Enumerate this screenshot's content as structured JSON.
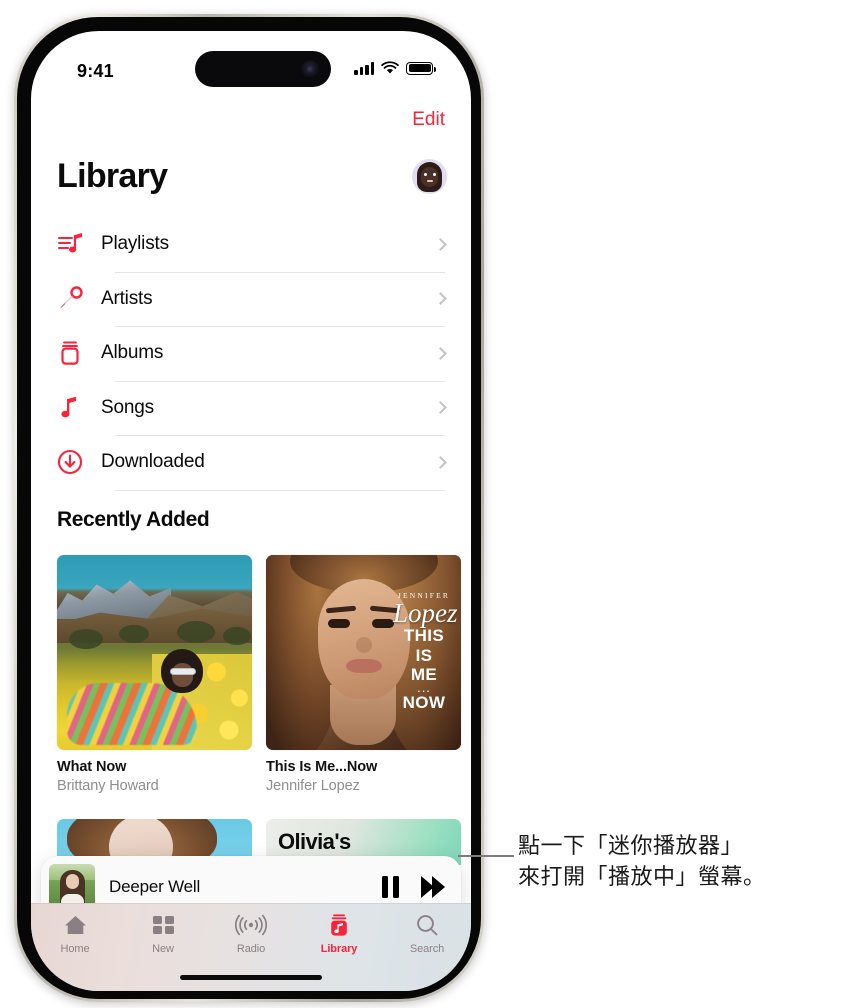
{
  "status_bar": {
    "time": "9:41",
    "icons": [
      "cellular-signal-icon",
      "wifi-icon",
      "battery-icon"
    ]
  },
  "nav": {
    "edit_label": "Edit",
    "title": "Library",
    "avatar_name": "memoji-avatar"
  },
  "library_rows": [
    {
      "label": "Playlists",
      "icon": "playlists-icon"
    },
    {
      "label": "Artists",
      "icon": "microphone-icon"
    },
    {
      "label": "Albums",
      "icon": "albums-icon"
    },
    {
      "label": "Songs",
      "icon": "music-note-icon"
    },
    {
      "label": "Downloaded",
      "icon": "download-circle-icon"
    }
  ],
  "recently_added": {
    "section_title": "Recently Added",
    "albums": [
      {
        "title": "What Now",
        "artist": "Brittany Howard"
      },
      {
        "title": "This Is Me...Now",
        "artist": "Jennifer Lopez"
      }
    ],
    "jlo_art_text": {
      "artist_name": "JENNIFER",
      "script": "Lopez",
      "line1": "THIS",
      "line2": "IS",
      "line3": "ME",
      "dots": "...",
      "line4": "NOW"
    },
    "second_row_partial": [
      {
        "title_overlay": ""
      },
      {
        "title_overlay": "Olivia's"
      }
    ]
  },
  "mini_player": {
    "track_title": "Deeper Well",
    "pause_icon": "pause-icon",
    "forward_icon": "fast-forward-icon",
    "artwork_name": "deeper-well-artwork"
  },
  "tab_bar": {
    "tabs": [
      {
        "label": "Home",
        "icon": "home-icon",
        "active": false
      },
      {
        "label": "New",
        "icon": "grid-icon",
        "active": false
      },
      {
        "label": "Radio",
        "icon": "radio-icon",
        "active": false
      },
      {
        "label": "Library",
        "icon": "library-icon",
        "active": true
      },
      {
        "label": "Search",
        "icon": "search-icon",
        "active": false
      }
    ]
  },
  "callout": {
    "line1": "點一下「迷你播放器」",
    "line2": "來打開「播放中」螢幕。"
  },
  "colors": {
    "accent_red": "#fa233b",
    "text_primary": "#0b0b0b",
    "text_secondary": "#8d8d92",
    "separator": "#e4e4e6",
    "tabbar_inactive": "#8a8084"
  }
}
